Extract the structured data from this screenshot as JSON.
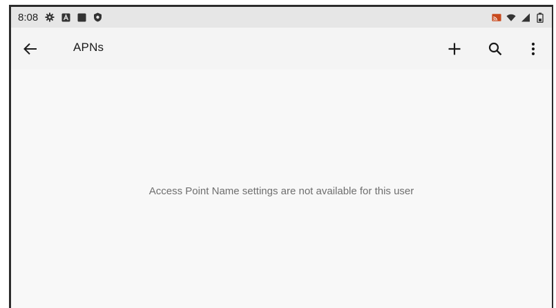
{
  "status_bar": {
    "time": "8:08",
    "left_icons": [
      "settings-gear-icon",
      "a-box-icon",
      "square-stop-icon",
      "shield-icon"
    ],
    "right_icons": [
      "cast-icon",
      "wifi-icon",
      "cell-signal-icon",
      "battery-icon"
    ],
    "background": "#e6e6e6"
  },
  "app_bar": {
    "title": "APNs",
    "actions": [
      "add-icon",
      "search-icon",
      "more-vert-icon"
    ],
    "background": "#f4f4f4"
  },
  "content": {
    "empty_message": "Access Point Name settings are not available for this user",
    "background": "#f8f8f8",
    "text_color": "#6e6e6e"
  }
}
